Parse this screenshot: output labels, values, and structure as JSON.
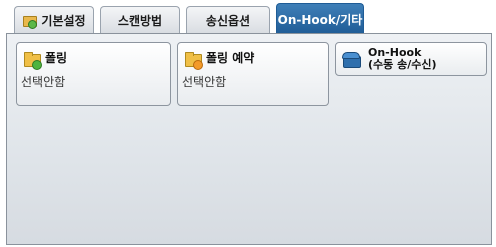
{
  "tabs": [
    {
      "label": "기본설정",
      "active": false
    },
    {
      "label": "스캔방법",
      "active": false
    },
    {
      "label": "송신옵션",
      "active": false
    },
    {
      "label": "On-Hook/기타",
      "active": true
    }
  ],
  "buttons": {
    "polling": {
      "title": "폴링",
      "value": "선택안함",
      "icon": "folder-icon"
    },
    "polling_reserve": {
      "title": "폴링 예약",
      "value": "선택안함",
      "icon": "folder-icon"
    },
    "onhook": {
      "line1": "On-Hook",
      "line2": "(수동 송/수신)",
      "icon": "phone-icon"
    }
  }
}
